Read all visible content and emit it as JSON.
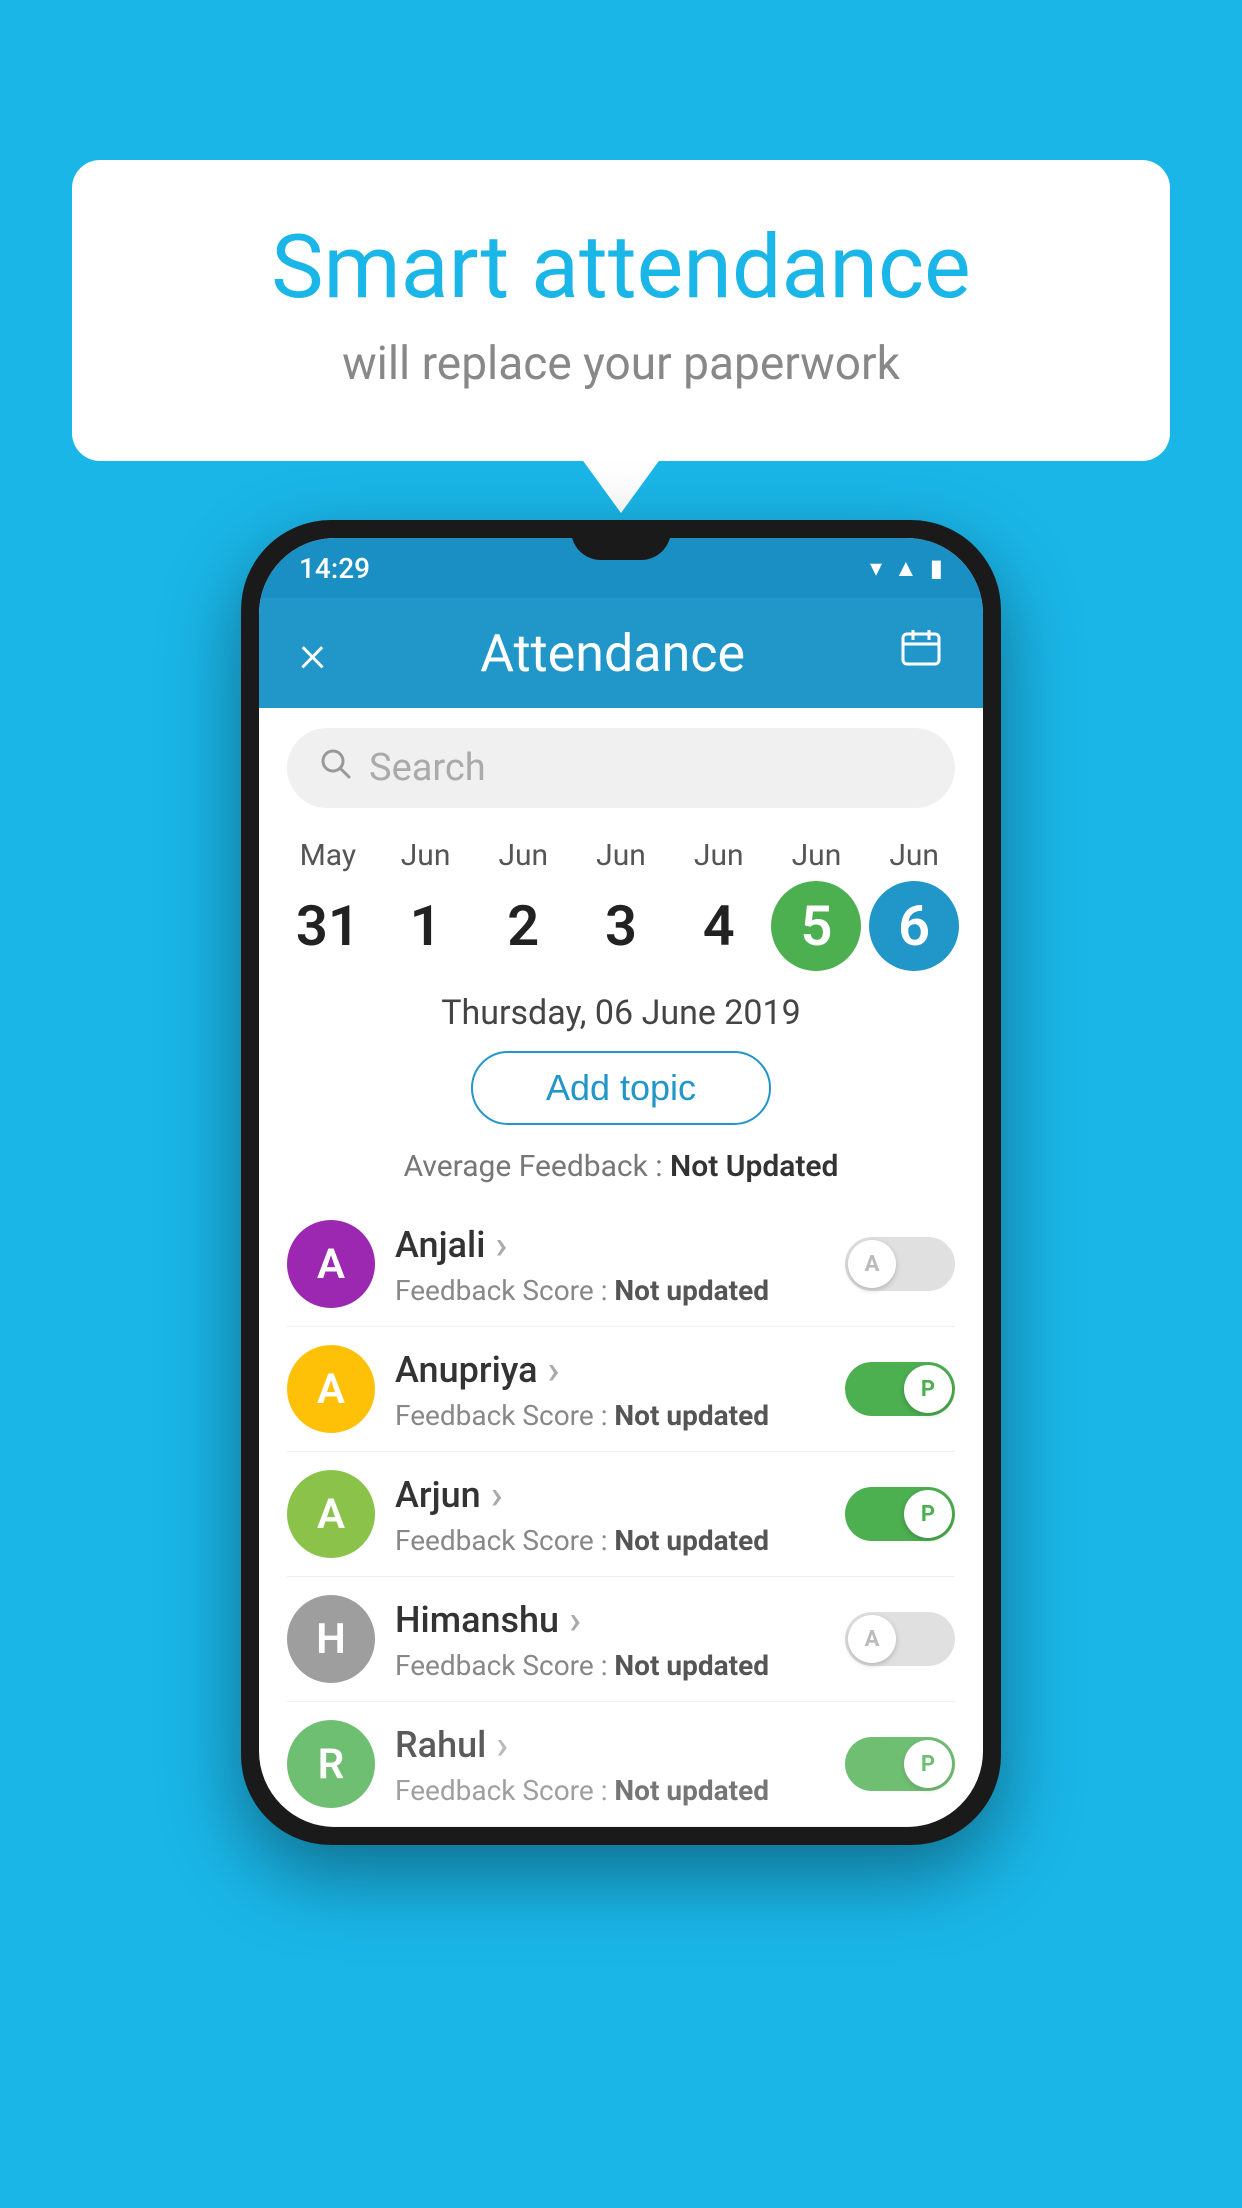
{
  "background_color": "#1ab6e8",
  "speech_bubble": {
    "title": "Smart attendance",
    "subtitle": "will replace your paperwork"
  },
  "status_bar": {
    "time": "14:29",
    "icons": [
      "wifi",
      "signal",
      "battery"
    ]
  },
  "app_header": {
    "title": "Attendance",
    "close_label": "×",
    "calendar_icon": "📅"
  },
  "search": {
    "placeholder": "Search"
  },
  "dates": [
    {
      "month": "May",
      "day": "31",
      "type": "normal"
    },
    {
      "month": "Jun",
      "day": "1",
      "type": "normal"
    },
    {
      "month": "Jun",
      "day": "2",
      "type": "normal"
    },
    {
      "month": "Jun",
      "day": "3",
      "type": "normal"
    },
    {
      "month": "Jun",
      "day": "4",
      "type": "normal"
    },
    {
      "month": "Jun",
      "day": "5",
      "type": "today"
    },
    {
      "month": "Jun",
      "day": "6",
      "type": "selected"
    }
  ],
  "selected_date_label": "Thursday, 06 June 2019",
  "add_topic_label": "Add topic",
  "average_feedback_label": "Average Feedback :",
  "average_feedback_value": "Not Updated",
  "students": [
    {
      "name": "Anjali",
      "avatar_letter": "A",
      "avatar_color": "#9c27b0",
      "feedback_label": "Feedback Score :",
      "feedback_value": "Not updated",
      "attendance": "absent",
      "toggle_letter": "A"
    },
    {
      "name": "Anupriya",
      "avatar_letter": "A",
      "avatar_color": "#ffc107",
      "feedback_label": "Feedback Score :",
      "feedback_value": "Not updated",
      "attendance": "present",
      "toggle_letter": "P"
    },
    {
      "name": "Arjun",
      "avatar_letter": "A",
      "avatar_color": "#8bc34a",
      "feedback_label": "Feedback Score :",
      "feedback_value": "Not updated",
      "attendance": "present",
      "toggle_letter": "P"
    },
    {
      "name": "Himanshu",
      "avatar_letter": "H",
      "avatar_color": "#9e9e9e",
      "feedback_label": "Feedback Score :",
      "feedback_value": "Not updated",
      "attendance": "absent",
      "toggle_letter": "A"
    },
    {
      "name": "Rahul",
      "avatar_letter": "R",
      "avatar_color": "#4caf50",
      "feedback_label": "Feedback Score :",
      "feedback_value": "Not updated",
      "attendance": "present",
      "toggle_letter": "P",
      "partial": true
    }
  ]
}
